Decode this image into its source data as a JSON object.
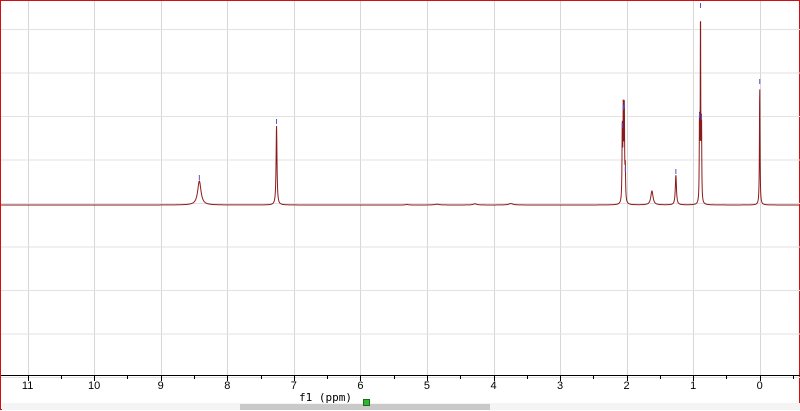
{
  "chart_data": {
    "type": "line",
    "title": "",
    "xlabel": "f1 (ppm)",
    "ylabel": "",
    "x_reversed": true,
    "xlim": [
      11.4,
      -0.62
    ],
    "ylim": [
      -0.85,
      1.02
    ],
    "x_ticks": [
      "11",
      "10",
      "9",
      "8",
      "7",
      "6",
      "5",
      "4",
      "3",
      "2",
      "1",
      "0"
    ],
    "grid": true,
    "line_color": "#8b1a1a",
    "peak_marker_color": "#5a4fd0",
    "series": [
      {
        "peaks": [
          {
            "ppm": 8.42,
            "height": 0.12,
            "width": 0.03
          },
          {
            "ppm": 7.26,
            "height": 0.4,
            "width": 0.008
          },
          {
            "ppm": 5.3,
            "height": 0.003,
            "width": 0.02
          },
          {
            "ppm": 4.85,
            "height": 0.004,
            "width": 0.04
          },
          {
            "ppm": 4.28,
            "height": 0.006,
            "width": 0.03
          },
          {
            "ppm": 3.74,
            "height": 0.007,
            "width": 0.04
          },
          {
            "ppm": 2.065,
            "height": 0.38,
            "width": 0.005
          },
          {
            "ppm": 2.05,
            "height": 0.47,
            "width": 0.005
          },
          {
            "ppm": 2.035,
            "height": 0.48,
            "width": 0.005
          },
          {
            "ppm": 2.02,
            "height": 0.16,
            "width": 0.005
          },
          {
            "ppm": 1.62,
            "height": 0.07,
            "width": 0.02
          },
          {
            "ppm": 1.26,
            "height": 0.15,
            "width": 0.01
          },
          {
            "ppm": 0.905,
            "height": 0.43,
            "width": 0.004
          },
          {
            "ppm": 0.89,
            "height": 0.98,
            "width": 0.004
          },
          {
            "ppm": 0.875,
            "height": 0.42,
            "width": 0.004
          },
          {
            "ppm": 0.0,
            "height": 0.6,
            "width": 0.005
          }
        ]
      }
    ]
  }
}
